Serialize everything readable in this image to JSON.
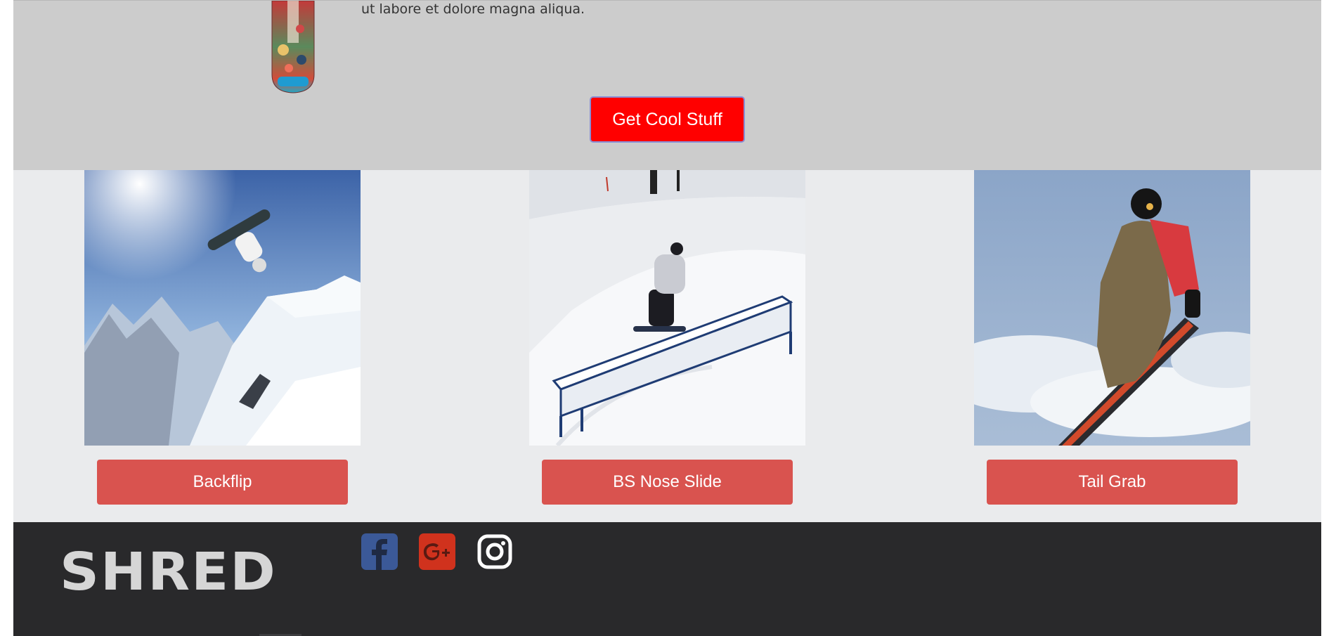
{
  "hero": {
    "text": "ut labore et dolore magna aliqua.",
    "cta_label": "Get Cool Stuff"
  },
  "tricks": [
    {
      "label": "Backflip"
    },
    {
      "label": "BS Nose Slide"
    },
    {
      "label": "Tail Grab"
    }
  ],
  "footer": {
    "logo_text": "SHRED",
    "social": [
      "facebook-icon",
      "google-plus-icon",
      "instagram-icon"
    ]
  },
  "colors": {
    "hero_bg": "#cccccc",
    "cta_bg": "#ff0000",
    "trick_button_bg": "#d9534f",
    "footer_bg": "#29292b",
    "facebook": "#3b5998",
    "google_plus": "#d0321d"
  }
}
